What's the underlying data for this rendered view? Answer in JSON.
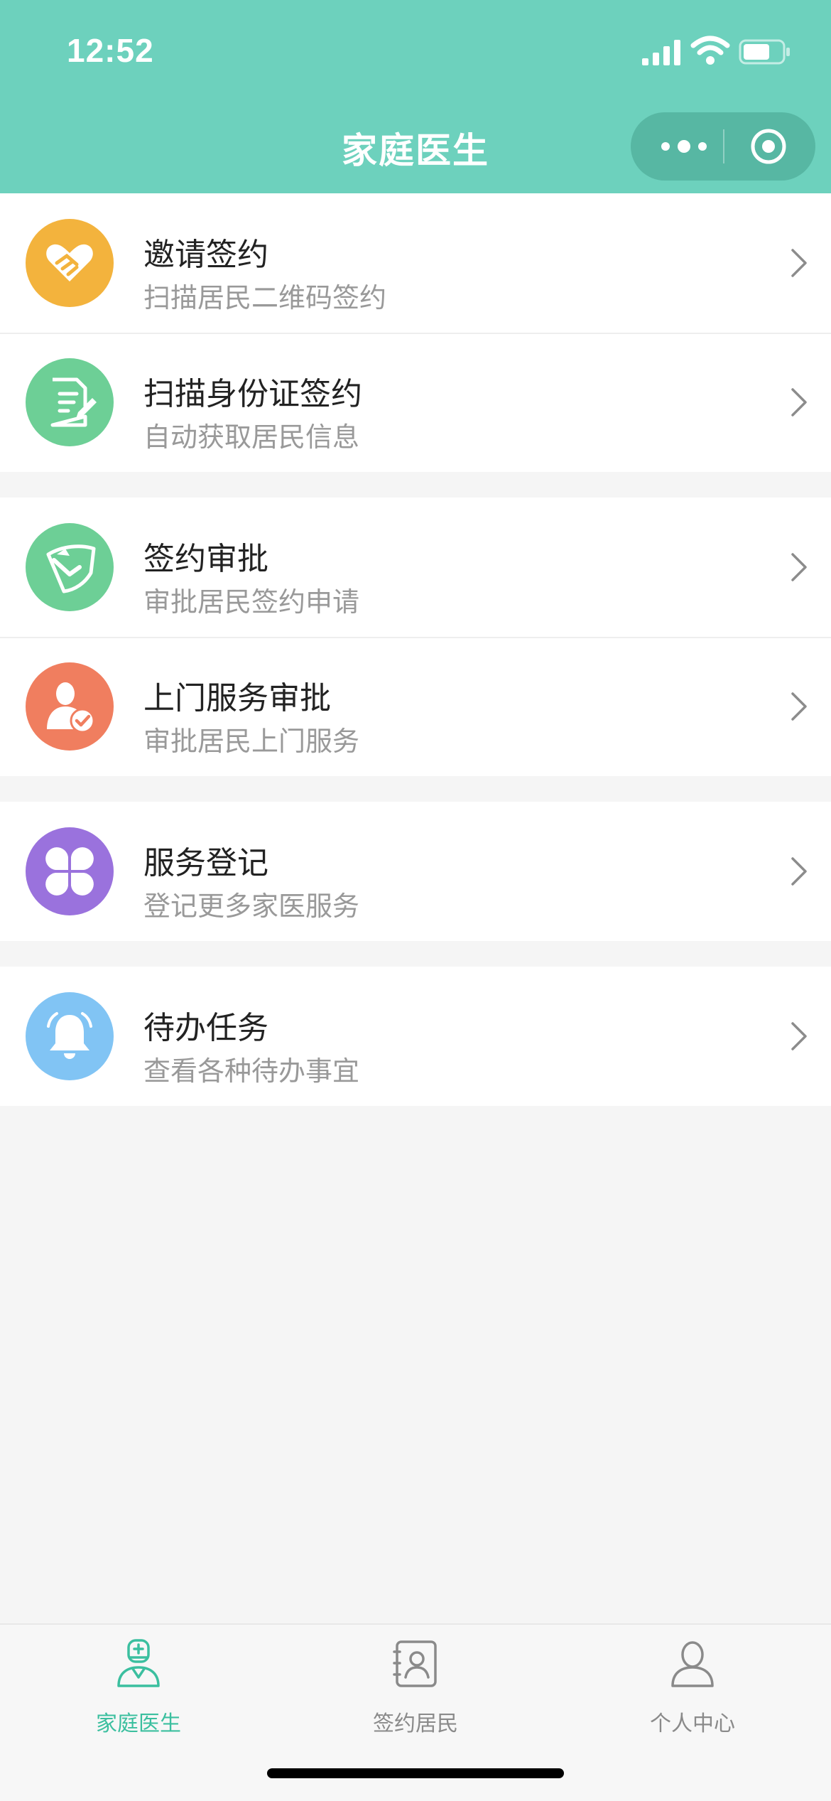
{
  "status_bar": {
    "time": "12:52",
    "icons": [
      "cellular-signal-icon",
      "wifi-icon",
      "battery-icon"
    ]
  },
  "nav": {
    "title": "家庭医生",
    "capsule_icons": [
      "more-dots-icon",
      "close-target-icon"
    ]
  },
  "menu_groups": [
    {
      "items": [
        {
          "title": "邀请签约",
          "subtitle": "扫描居民二维码签约",
          "icon": "handshake-heart-icon",
          "color": "#f3b33d"
        },
        {
          "title": "扫描身份证签约",
          "subtitle": "自动获取居民信息",
          "icon": "document-edit-icon",
          "color": "#6dcf96"
        }
      ]
    },
    {
      "items": [
        {
          "title": "签约审批",
          "subtitle": "审批居民签约申请",
          "icon": "approval-pen-icon",
          "color": "#6dcf96"
        },
        {
          "title": "上门服务审批",
          "subtitle": "审批居民上门服务",
          "icon": "person-check-icon",
          "color": "#f07e5f"
        }
      ]
    },
    {
      "items": [
        {
          "title": "服务登记",
          "subtitle": "登记更多家医服务",
          "icon": "clover-icon",
          "color": "#9a72dd"
        }
      ]
    },
    {
      "items": [
        {
          "title": "待办任务",
          "subtitle": "查看各种待办事宜",
          "icon": "bell-icon",
          "color": "#81c4f4"
        }
      ]
    }
  ],
  "tabbar": {
    "active": 0,
    "tabs": [
      {
        "label": "家庭医生",
        "icon": "doctor-icon"
      },
      {
        "label": "签约居民",
        "icon": "contact-book-icon"
      },
      {
        "label": "个人中心",
        "icon": "user-icon"
      }
    ]
  },
  "colors": {
    "primary": "#6dd1bd",
    "tab_active": "#3bbf9f",
    "background": "#f5f5f5"
  }
}
